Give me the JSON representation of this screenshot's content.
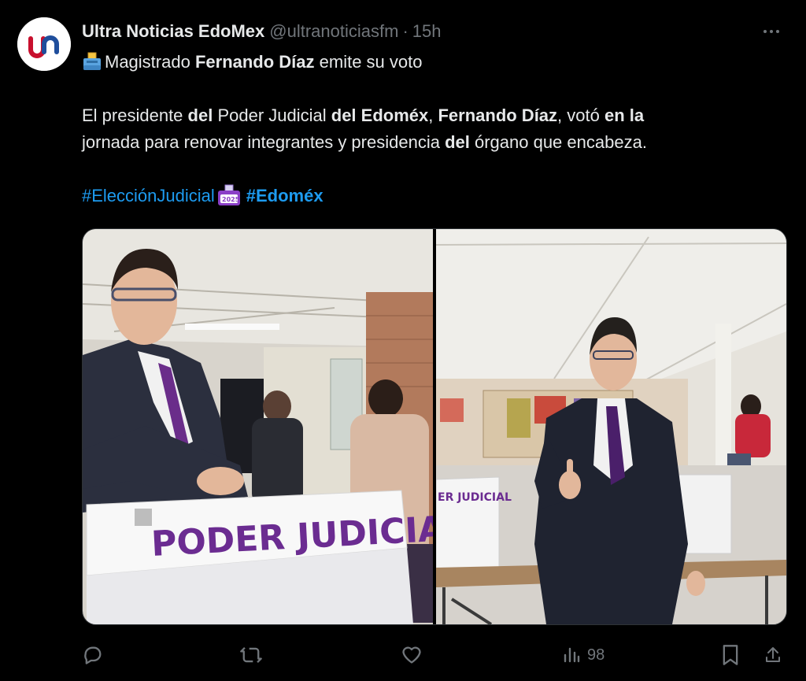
{
  "author": {
    "display_name": "Ultra Noticias EdoMex",
    "handle": "@ultranoticiasfm",
    "separator": "·",
    "time": "15h",
    "avatar_text": "un"
  },
  "tweet": {
    "headline_prefix": "Magistrado ",
    "headline_bold": "Fernando Díaz",
    "headline_suffix": " emite su voto",
    "p1": "El presidente ",
    "p1_b1": "del",
    "p2": " Poder Judicial ",
    "p2_b2": "del Edoméx",
    "p3": ", ",
    "p3_b3": "Fernando Díaz",
    "p4": ", votó ",
    "p4_b4": "en la",
    "p5": "jornada para renovar integrantes y presidencia ",
    "p5_b5": "del",
    "p6": " órgano que encabeza.",
    "hashtag1": "#ElecciónJudicial",
    "hashtag2": "#Edoméx"
  },
  "media": {
    "left_box_text": "PODER JUDICIAL",
    "right_box_text": "ER JUDICIAL"
  },
  "actions": {
    "views": "98"
  },
  "colors": {
    "background": "#000000",
    "text": "#e7e9ea",
    "muted": "#71767b",
    "link": "#1d9bf0",
    "box_purple": "#6b2c91"
  }
}
